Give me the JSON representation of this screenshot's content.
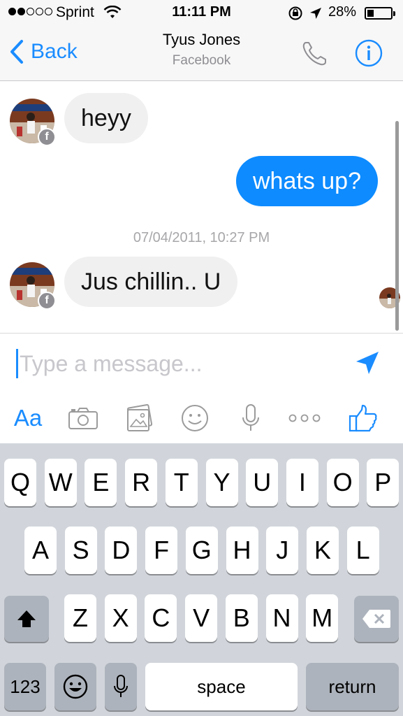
{
  "status_bar": {
    "carrier": "Sprint",
    "time": "11:11 PM",
    "battery": "28%",
    "battery_level": 0.28,
    "signal_bars_filled": 2,
    "signal_bars_total": 5
  },
  "nav": {
    "back_label": "Back",
    "title": "Tyus Jones",
    "subtitle": "Facebook",
    "accent": "#1a8cff"
  },
  "messages": [
    {
      "direction": "incoming",
      "text": "heyy"
    },
    {
      "direction": "outgoing",
      "text": "whats up?"
    },
    {
      "direction": "incoming",
      "text": "Jus chillin.. U"
    }
  ],
  "timestamp": "07/04/2011, 10:27 PM",
  "composer": {
    "placeholder": "Type a message...",
    "tools": [
      "Aa",
      "camera-icon",
      "photos-icon",
      "emoji-icon",
      "microphone-icon",
      "more-icon",
      "like-icon"
    ]
  },
  "keyboard": {
    "row1": [
      "Q",
      "W",
      "E",
      "R",
      "T",
      "Y",
      "U",
      "I",
      "O",
      "P"
    ],
    "row2": [
      "A",
      "S",
      "D",
      "F",
      "G",
      "H",
      "J",
      "K",
      "L"
    ],
    "row3": [
      "Z",
      "X",
      "C",
      "V",
      "B",
      "N",
      "M"
    ],
    "numbers_key": "123",
    "space_key": "space",
    "return_key": "return"
  },
  "colors": {
    "outgoing_bubble": "#0d8bff",
    "incoming_bubble": "#f1f0f0",
    "keyboard_bg": "#d1d5db"
  }
}
